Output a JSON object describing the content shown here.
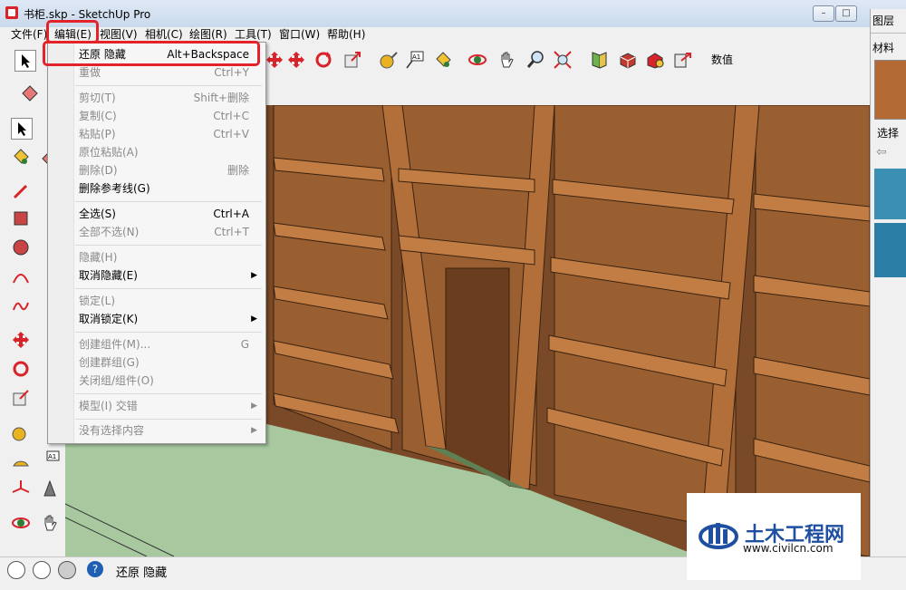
{
  "window": {
    "title": "书柜.skp - SketchUp Pro",
    "min": "–",
    "max": "□",
    "close": "✕"
  },
  "menubar": {
    "items": [
      "文件(F)",
      "编辑(E)",
      "视图(V)",
      "相机(C)",
      "绘图(R)",
      "工具(T)",
      "窗口(W)",
      "帮助(H)"
    ]
  },
  "toolbar": {
    "value_label": "数值"
  },
  "edit_menu": {
    "items": [
      {
        "label": "还原 隐藏",
        "shortcut": "Alt+Backspace",
        "enabled": true
      },
      {
        "label": "重做",
        "shortcut": "Ctrl+Y",
        "enabled": false
      },
      {
        "label": "剪切(T)",
        "shortcut": "Shift+删除",
        "enabled": false
      },
      {
        "label": "复制(C)",
        "shortcut": "Ctrl+C",
        "enabled": false
      },
      {
        "label": "粘贴(P)",
        "shortcut": "Ctrl+V",
        "enabled": false
      },
      {
        "label": "原位粘贴(A)",
        "shortcut": "",
        "enabled": false
      },
      {
        "label": "删除(D)",
        "shortcut": "删除",
        "enabled": false
      },
      {
        "label": "删除参考线(G)",
        "shortcut": "",
        "enabled": true
      },
      {
        "label": "全选(S)",
        "shortcut": "Ctrl+A",
        "enabled": true
      },
      {
        "label": "全部不选(N)",
        "shortcut": "Ctrl+T",
        "enabled": false
      },
      {
        "label": "隐藏(H)",
        "shortcut": "",
        "enabled": false
      },
      {
        "label": "取消隐藏(E)",
        "shortcut": "",
        "enabled": true
      },
      {
        "label": "锁定(L)",
        "shortcut": "",
        "enabled": false
      },
      {
        "label": "取消锁定(K)",
        "shortcut": "",
        "enabled": true
      },
      {
        "label": "创建组件(M)...",
        "shortcut": "G",
        "enabled": false
      },
      {
        "label": "创建群组(G)",
        "shortcut": "",
        "enabled": false
      },
      {
        "label": "关闭组/组件(O)",
        "shortcut": "",
        "enabled": false
      },
      {
        "label": "模型(I) 交错",
        "shortcut": "",
        "enabled": false
      },
      {
        "label": "没有选择内容",
        "shortcut": "",
        "enabled": false
      }
    ]
  },
  "tray": {
    "layers_label": "图层",
    "materials_label": "材料",
    "select_label": "选择"
  },
  "statusbar": {
    "text": "还原 隐藏",
    "help": "?"
  },
  "watermark": {
    "name": "土木工程网",
    "url": "www.civilcn.com"
  }
}
